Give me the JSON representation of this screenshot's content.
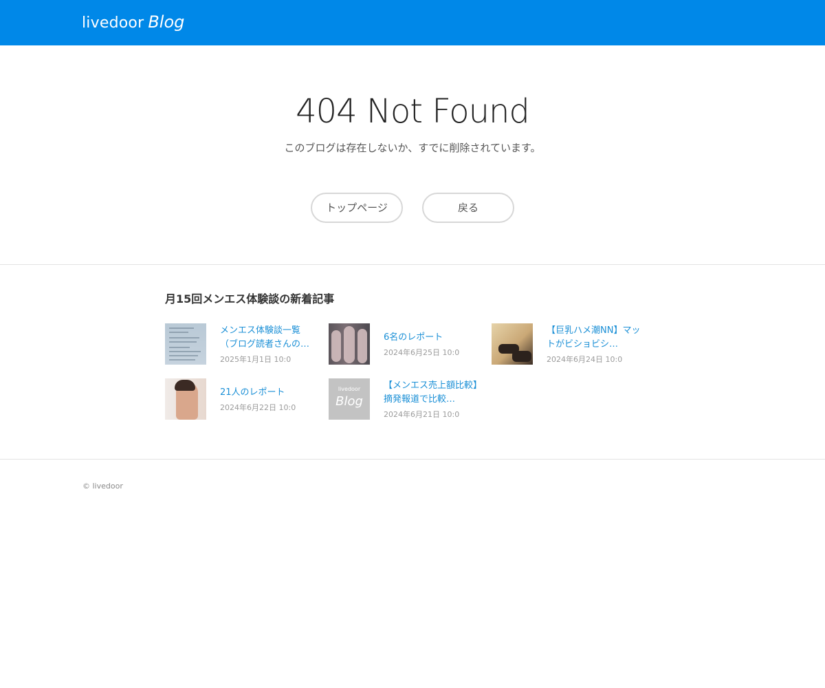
{
  "header": {
    "logo_word": "livedoor",
    "logo_blog": "Blog",
    "brand_color": "#0088e8"
  },
  "error": {
    "title": "404 Not Found",
    "message": "このブログは存在しないか、すでに削除されています。",
    "top_button": "トップページ",
    "back_button": "戻る"
  },
  "recent": {
    "heading": "月15回メンエス体験談の新着記事",
    "articles": [
      {
        "title": "メンエス体験談一覧（ブログ読者さんの…",
        "date": "2025年1月1日 10:0"
      },
      {
        "title": "6名のレポート",
        "date": "2024年6月25日 10:0"
      },
      {
        "title": "【巨乳ハメ潮NN】マットがビショビシ…",
        "date": "2024年6月24日 10:0"
      },
      {
        "title": "21人のレポート",
        "date": "2024年6月22日 10:0"
      },
      {
        "title": "【メンエス売上額比較】摘発報道で比較…",
        "date": "2024年6月21日 10:0"
      }
    ],
    "placeholder_thumb": {
      "word": "livedoor",
      "blog": "Blog"
    }
  },
  "footer": {
    "copyright": "© livedoor"
  }
}
